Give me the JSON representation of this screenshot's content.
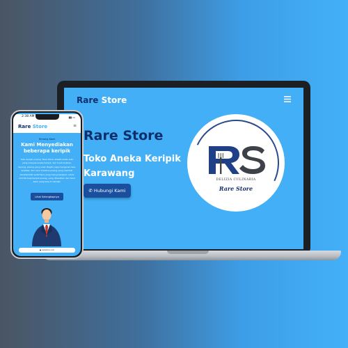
{
  "laptop": {
    "brand_main": "Rare ",
    "brand_accent": "Store",
    "menu_icon": "hamburger-icon",
    "hero_title": "Rare Store",
    "hero_subtitle": "Toko Aneka Keripik Karawang",
    "cta_icon": "phone-icon",
    "cta_label": "Hubungi Kami",
    "logo": {
      "monogram": "RS",
      "tagline": "DELIZIA CULINARIA",
      "name": "Rare Store"
    }
  },
  "phone": {
    "status_time": "2:38 AM",
    "brand_main": "Rare ",
    "brand_accent": "Store",
    "menu_icon": "hamburger-icon",
    "kicker": "Tentang Kami",
    "title": "Kami Menyediakan beberapa keripik",
    "body": "Toko keripik (nama) 'Rare Store' adalah suatu toko yang menjual aneka keripik, dari buah-buahan, tepung, pisang yang enak. Begitu juga mengenai rasa, kualitas, dan cara merebus pisang yang memiliki karakteristik sederhana yang menyenangkan untuk dimiliki bagi keripik pisang, yang dihasilkan dari hasil alam yang bisa di nikmati.",
    "cta_label": "Lihat Selengkapnya",
    "url": "rarestore.com"
  },
  "colors": {
    "screen_blue": "#42aff6",
    "brand_navy": "#0f2f6b",
    "button_blue": "#1a4f9e"
  }
}
